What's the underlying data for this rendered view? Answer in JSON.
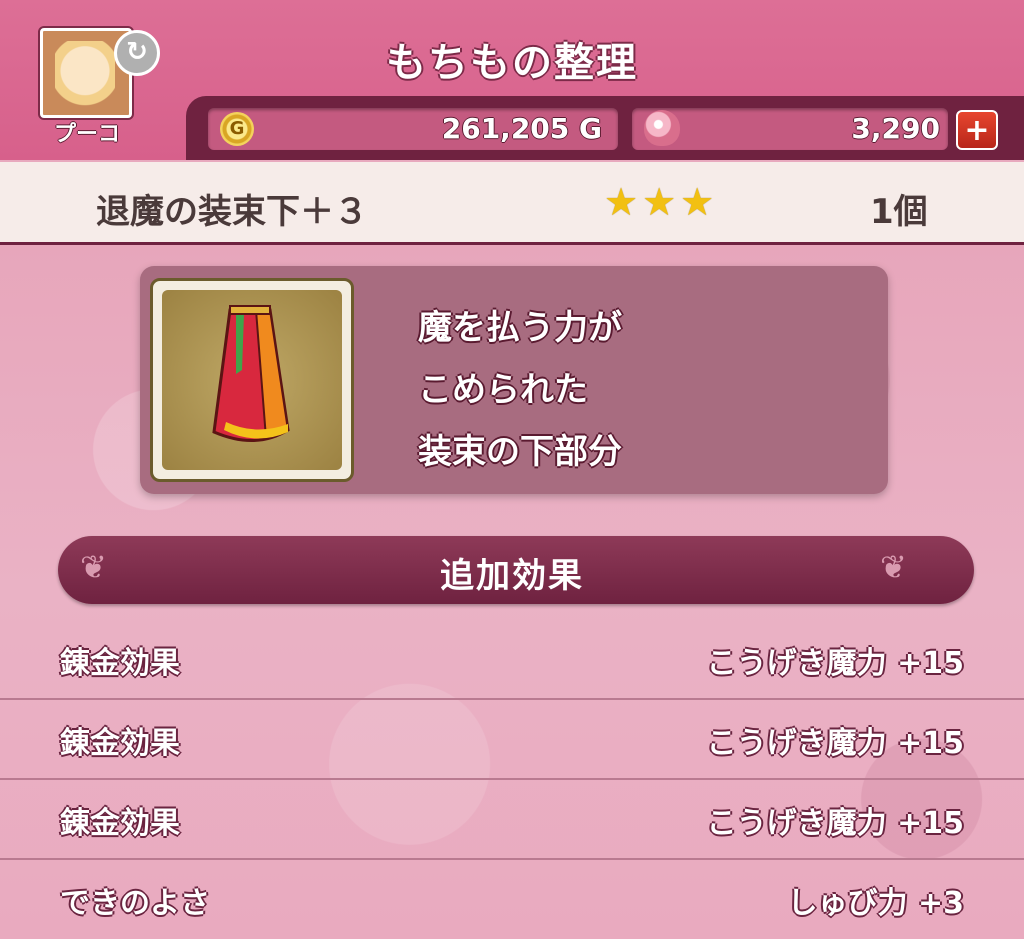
{
  "header": {
    "title": "もちもの整理",
    "player_name": "プーコ"
  },
  "currency": {
    "gold": "261,205 G",
    "gold_icon": "G",
    "gems": "3,290",
    "add_label": "+"
  },
  "item": {
    "name": "退魔の装束下＋３",
    "stars": "★★★",
    "star_count": 3,
    "count": "1個",
    "description": [
      "魔を払う力が",
      "こめられた",
      "装束の下部分"
    ]
  },
  "extra_effects": {
    "title": "追加効果",
    "rows": [
      {
        "label": "錬金効果",
        "value": "こうげき魔力  +15"
      },
      {
        "label": "錬金効果",
        "value": "こうげき魔力  +15"
      },
      {
        "label": "錬金効果",
        "value": "こうげき魔力  +15"
      },
      {
        "label": "できのよさ",
        "value": "しゅび力  +3"
      }
    ]
  },
  "colors": {
    "header": "#d7608b",
    "dark_bar": "#6f2240",
    "star": "#f2c012",
    "add_button": "#d0321f"
  }
}
